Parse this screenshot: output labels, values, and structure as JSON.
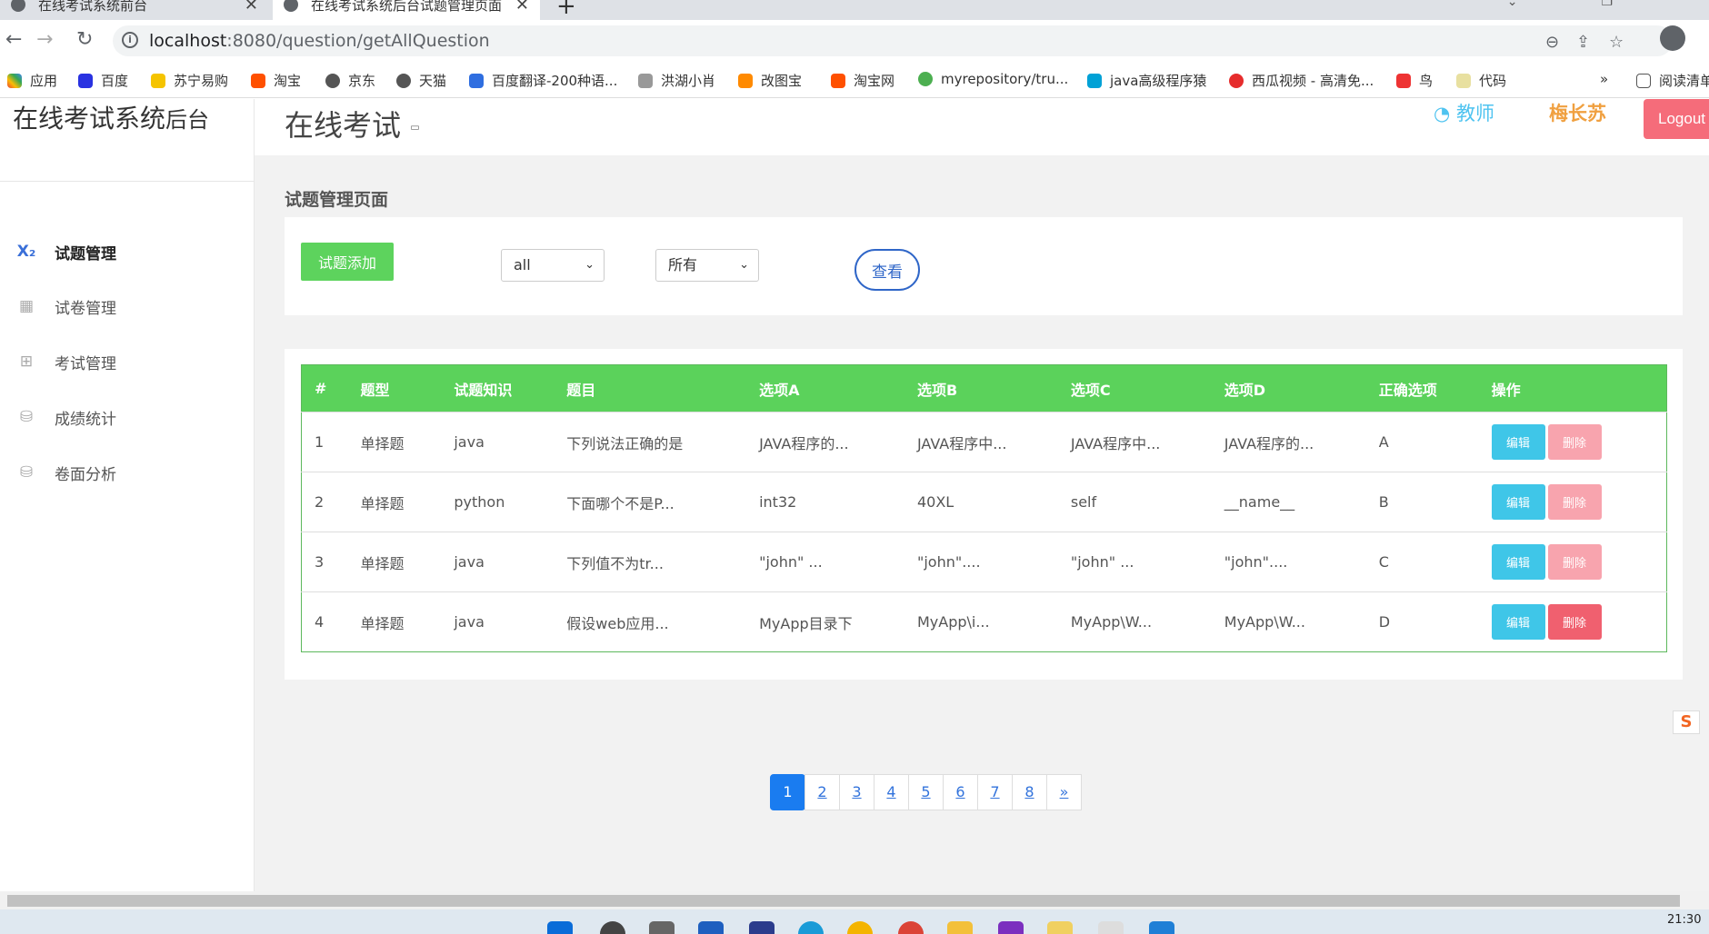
{
  "browser": {
    "tabs": [
      {
        "title": "在线考试系统前台",
        "active": false
      },
      {
        "title": "在线考试系统后台试题管理页面",
        "active": true
      }
    ],
    "url_host": "localhost",
    "url_path": ":8080/question/getAllQuestion",
    "bookmarks": [
      "应用",
      "百度",
      "苏宁易购",
      "淘宝",
      "京东",
      "天猫",
      "百度翻译-200种语...",
      "洪湖小肖",
      "改图宝",
      "淘宝网",
      "myrepository/tru...",
      "java高级程序猿",
      "西瓜视频 - 高清免...",
      "鸟",
      "代码",
      "»",
      "阅读清单"
    ]
  },
  "sidebar": {
    "title_main": "在线考试系统",
    "title_suffix": "后台",
    "items": [
      {
        "label": "试题管理",
        "icon": "subscript-x-icon",
        "active": true
      },
      {
        "label": "试卷管理",
        "icon": "grid-icon",
        "active": false
      },
      {
        "label": "考试管理",
        "icon": "map-icon",
        "active": false
      },
      {
        "label": "成绩统计",
        "icon": "sitemap-icon",
        "active": false
      },
      {
        "label": "卷面分析",
        "icon": "sitemap-icon",
        "active": false
      }
    ]
  },
  "header": {
    "brand": "在线考试",
    "role": "教师",
    "username": "梅长苏",
    "logout_label": "Logout"
  },
  "main": {
    "heading": "试题管理页面",
    "add_button": "试题添加",
    "filter_type_value": "all",
    "filter_scope_value": "所有",
    "view_button": "查看"
  },
  "table": {
    "columns": [
      "#",
      "题型",
      "试题知识",
      "题目",
      "选项A",
      "选项B",
      "选项C",
      "选项D",
      "正确选项",
      "操作"
    ],
    "edit_label": "编辑",
    "delete_label": "删除",
    "rows": [
      {
        "id": "1",
        "type": "单择题",
        "knowledge": "java",
        "question": "下列说法正确的是",
        "a": "JAVA程序的...",
        "b": "JAVA程序中...",
        "c": "JAVA程序中...",
        "d": "JAVA程序的...",
        "answer": "A"
      },
      {
        "id": "2",
        "type": "单择题",
        "knowledge": "python",
        "question": "下面哪个不是P...",
        "a": "int32",
        "b": "40XL",
        "c": "self",
        "d": "__name__",
        "answer": "B"
      },
      {
        "id": "3",
        "type": "单择题",
        "knowledge": "java",
        "question": "下列值不为tr...",
        "a": "\"john\" ...",
        "b": "\"john\"....",
        "c": "\"john\" ...",
        "d": "\"john\"....",
        "answer": "C"
      },
      {
        "id": "4",
        "type": "单择题",
        "knowledge": "java",
        "question": "假设web应用...",
        "a": "MyApp目录下",
        "b": "MyApp\\i...",
        "c": "MyApp\\W...",
        "d": "MyApp\\W...",
        "answer": "D"
      }
    ]
  },
  "pagination": {
    "pages": [
      "1",
      "2",
      "3",
      "4",
      "5",
      "6",
      "7",
      "8"
    ],
    "next": "»",
    "current": "1"
  },
  "system": {
    "clock": "21:30"
  },
  "colors": {
    "accent_green": "#5bd25b",
    "edit_blue": "#3fc6e8",
    "delete_red": "#f0606f",
    "logout_red": "#f56c7a",
    "page_active": "#1a7cf0"
  }
}
